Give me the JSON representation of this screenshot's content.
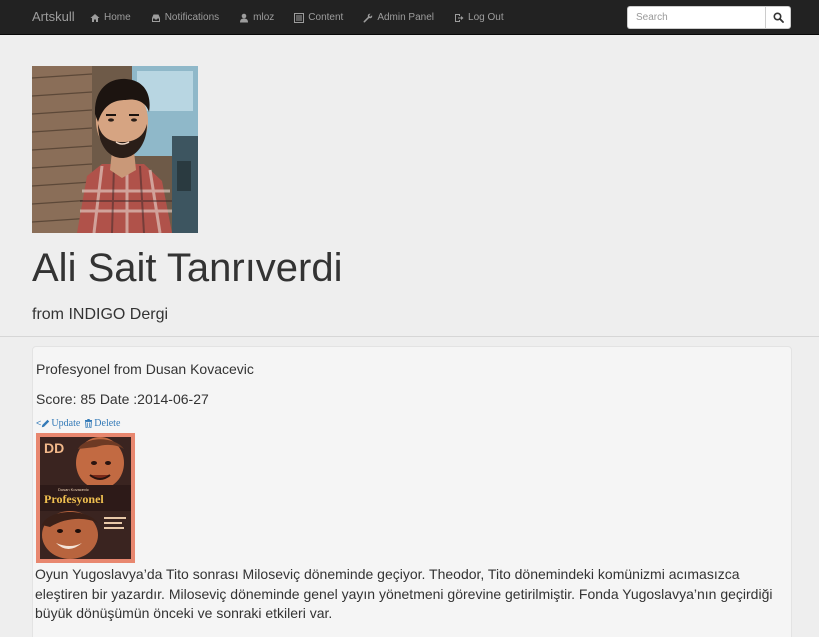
{
  "navbar": {
    "brand": "Artskull",
    "items": [
      {
        "label": "Home",
        "icon": "home-icon"
      },
      {
        "label": "Notifications",
        "icon": "inbox-icon"
      },
      {
        "label": "mloz",
        "icon": "user-icon"
      },
      {
        "label": "Content",
        "icon": "list-icon"
      },
      {
        "label": "Admin Panel",
        "icon": "wrench-icon"
      },
      {
        "label": "Log Out",
        "icon": "logout-icon"
      }
    ],
    "search": {
      "placeholder": "Search",
      "value": ""
    }
  },
  "profile": {
    "name": "Ali Sait Tanrıverdi",
    "subtitle": "from INDIGO Dergi"
  },
  "review": {
    "title": "Profesyonel from Dusan Kovacevic",
    "meta": "Score: 85 Date :2014-06-27",
    "update_label": "Update",
    "delete_label": "Delete",
    "cover_text_top": "Dusan Kovacevic",
    "cover_title": "Profesyonel",
    "body": "Oyun Yugoslavya’da Tito sonrası Miloseviç döneminde geçiyor. Theodor, Tito dönemindeki komünizmi acımasızca eleştiren bir yazardır. Miloseviç döneminde genel yayın yönetmeni görevine getirilmiştir. Fonda Yugoslavya’nın geçirdiği büyük dönüşümün önceki ve sonraki etkileri var."
  },
  "colors": {
    "navbar_bg": "#222222",
    "nav_text": "#9d9d9d",
    "page_bg": "#eeeeee",
    "card_bg": "#f5f5f5",
    "link": "#337ab7",
    "cover_bg": "#e8876f"
  }
}
